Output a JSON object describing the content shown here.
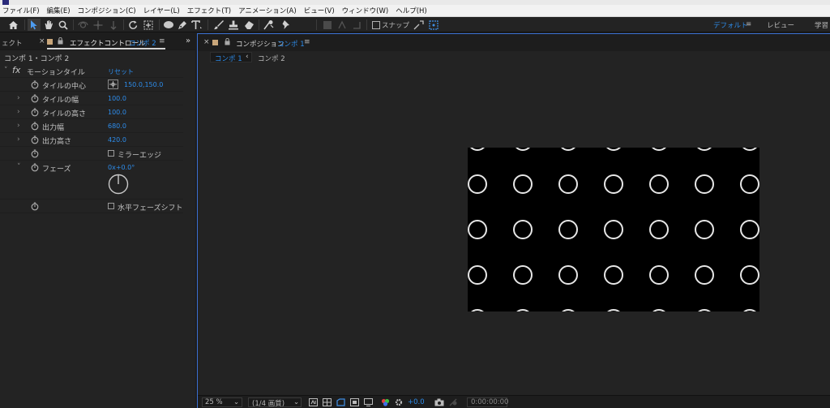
{
  "menubar": {
    "items": [
      "ファイル(F)",
      "編集(E)",
      "コンポジション(C)",
      "レイヤー(L)",
      "エフェクト(T)",
      "アニメーション(A)",
      "ビュー(V)",
      "ウィンドウ(W)",
      "ヘルプ(H)"
    ]
  },
  "toolbar": {
    "snap_label": "スナップ",
    "workspaces": [
      "デフォルト",
      "レビュー",
      "学習"
    ],
    "workspace_menu_icon": "≡"
  },
  "effects_panel": {
    "clipped_tab": "ェクト",
    "tab_title": "エフェクトコントロール",
    "tab_comp": "コンポ 2",
    "breadcrumb": "コンポ 1・コンポ 2",
    "effect": {
      "fx_label": "fx",
      "name": "モーションタイル",
      "reset": "リセット"
    },
    "params": [
      {
        "name": "タイルの中心",
        "value": "150.0,150.0"
      },
      {
        "name": "タイルの幅",
        "value": "100.0"
      },
      {
        "name": "タイルの高さ",
        "value": "100.0"
      },
      {
        "name": "出力幅",
        "value": "680.0"
      },
      {
        "name": "出力高さ",
        "value": "420.0"
      },
      {
        "name": "",
        "checkbox": "ミラーエッジ"
      },
      {
        "name": "フェーズ",
        "value": "0x+0.0°"
      },
      {
        "name": "",
        "checkbox": "水平フェーズシフト"
      }
    ]
  },
  "comp_panel": {
    "tab_title": "コンポジション",
    "tab_comp": "コンポ 1",
    "flow": [
      "コンポ 1",
      "コンポ 2"
    ],
    "flow_arrow": "‹",
    "bottom": {
      "zoom": "25 %",
      "resolution": "(1/4 画質)",
      "exposure": "+0.0",
      "timecode": "0:00:00:00"
    }
  },
  "colors": {
    "accent_blue": "#2d8ceb",
    "panel_bg": "#232323",
    "highlight_border": "#3a6fd1"
  }
}
